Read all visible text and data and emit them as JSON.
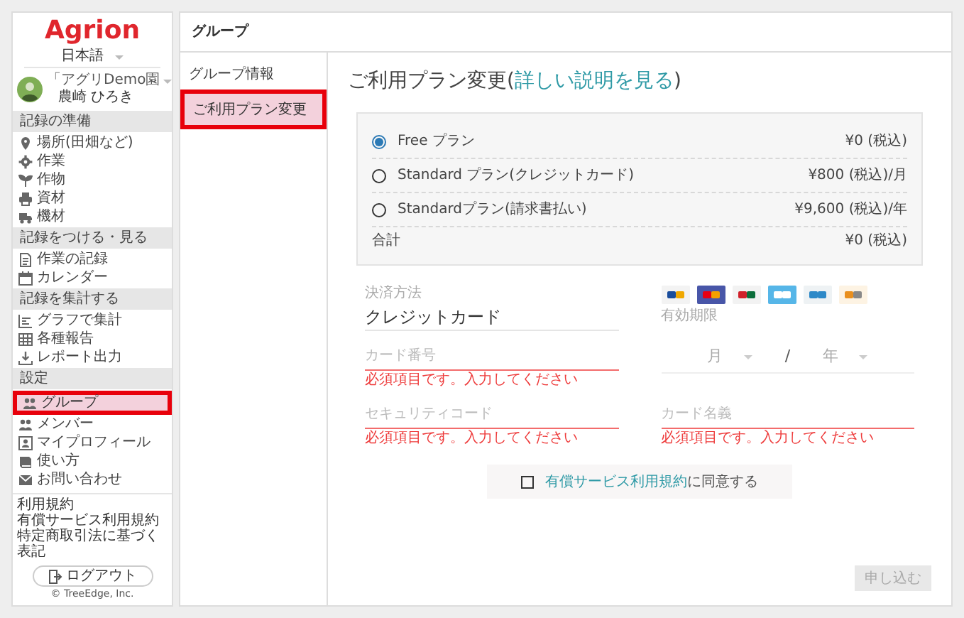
{
  "logo": "Agrion",
  "language": {
    "value": "日本語"
  },
  "user": {
    "group": "「アグリDemo園",
    "name": "農崎 ひろき"
  },
  "sidebar": {
    "sections": [
      {
        "title": "記録の準備",
        "items": [
          {
            "label": "場所(田畑など)",
            "selected": false,
            "outlined": false
          },
          {
            "label": "作業",
            "selected": false,
            "outlined": false
          },
          {
            "label": "作物",
            "selected": false,
            "outlined": false
          },
          {
            "label": "資材",
            "selected": false,
            "outlined": false
          },
          {
            "label": "機材",
            "selected": false,
            "outlined": false
          }
        ]
      },
      {
        "title": "記録をつける・見る",
        "items": [
          {
            "label": "作業の記録",
            "selected": false,
            "outlined": false
          },
          {
            "label": "カレンダー",
            "selected": false,
            "outlined": false
          }
        ]
      },
      {
        "title": "記録を集計する",
        "items": [
          {
            "label": "グラフで集計",
            "selected": false,
            "outlined": false
          },
          {
            "label": "各種報告",
            "selected": false,
            "outlined": false
          },
          {
            "label": "レポート出力",
            "selected": false,
            "outlined": false
          }
        ]
      },
      {
        "title": "設定",
        "items": [
          {
            "label": "グループ",
            "selected": true,
            "outlined": true
          },
          {
            "label": "メンバー",
            "selected": false,
            "outlined": false
          },
          {
            "label": "マイプロフィール",
            "selected": false,
            "outlined": false
          },
          {
            "label": "使い方",
            "selected": false,
            "outlined": false
          },
          {
            "label": "お問い合わせ",
            "selected": false,
            "outlined": false
          }
        ]
      }
    ],
    "footer_links": [
      "利用規約",
      "有償サービス利用規約",
      "特定商取引法に基づく表記"
    ],
    "logout": "ログアウト",
    "copyright": "© TreeEdge, Inc."
  },
  "page_title": "グループ",
  "submenu": [
    {
      "label": "グループ情報",
      "selected": false,
      "outlined": false
    },
    {
      "label": "ご利用プラン変更",
      "selected": true,
      "outlined": true
    }
  ],
  "heading": {
    "text": "ご利用プラン変更(",
    "link": "詳しい説明を見る",
    "suffix": ")"
  },
  "plans": [
    {
      "name": "Free プラン",
      "price": "¥0 (税込)",
      "selected": true
    },
    {
      "name": "Standard プラン(クレジットカード)",
      "price": "¥800 (税込)/月",
      "selected": false
    },
    {
      "name": "Standardプラン(請求書払い)",
      "price": "¥9,600 (税込)/年",
      "selected": false
    }
  ],
  "total": {
    "label": "合計",
    "value": "¥0 (税込)"
  },
  "payment_method": {
    "label": "決済方法",
    "value": "クレジットカード"
  },
  "card_number": {
    "placeholder": "カード番号",
    "error": "必須項目です。入力してください"
  },
  "expiry": {
    "label": "有効期限",
    "month": {
      "placeholder": "月"
    },
    "separator": "/",
    "year": {
      "placeholder": "年"
    }
  },
  "security_code": {
    "placeholder": "セキュリティコード",
    "error": "必須項目です。入力してください"
  },
  "card_holder": {
    "placeholder": "カード名義",
    "error": "必須項目です。入力してください"
  },
  "agreement": {
    "checked": false,
    "link": "有償サービス利用規約",
    "text": "に同意する"
  },
  "submit": {
    "label": "申し込む",
    "disabled": true
  }
}
